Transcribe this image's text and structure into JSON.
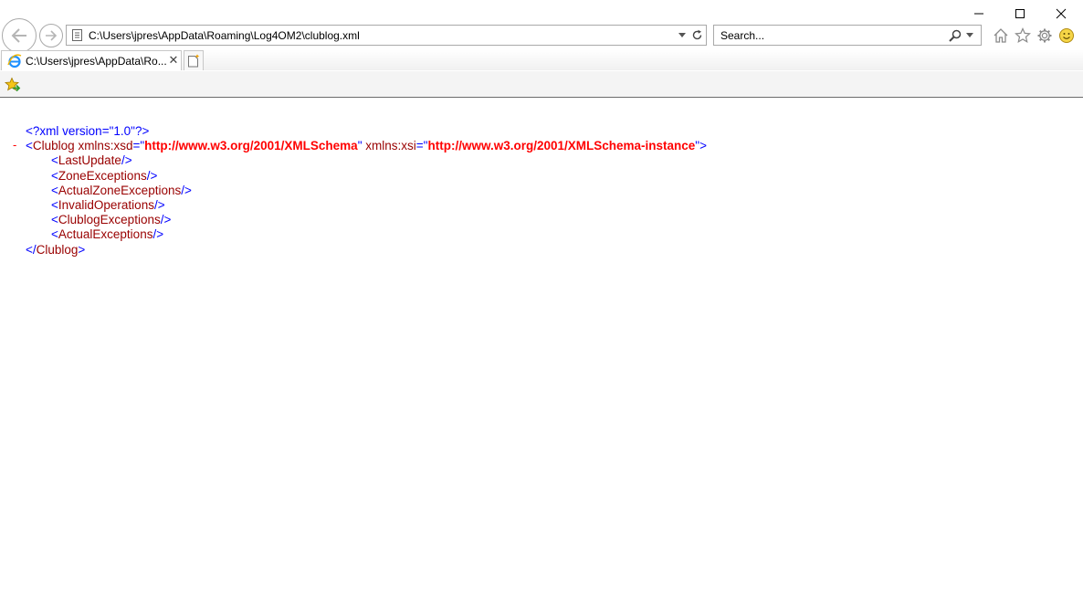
{
  "browser": {
    "address": "C:\\Users\\jpres\\AppData\\Roaming\\Log4OM2\\clublog.xml",
    "search_placeholder": "Search...",
    "tab_title": "C:\\Users\\jpres\\AppData\\Ro...",
    "tab_close": "✕",
    "icons": [
      "back-arrow-icon",
      "forward-arrow-icon",
      "page-icon",
      "dropdown-arrow-icon",
      "refresh-icon",
      "search-icon",
      "home-icon",
      "star-icon",
      "gear-icon",
      "smiley-icon",
      "ie-logo-icon",
      "new-tab-icon",
      "add-favorite-icon",
      "minimize-icon",
      "maximize-icon",
      "close-icon"
    ]
  },
  "xml": {
    "collapse_symbol": "-",
    "pi": {
      "open": "<?",
      "name": "xml",
      "attr": "version",
      "eq_quote": "=\"",
      "value": "1.0",
      "close": "\"?>"
    },
    "root": {
      "lt": "<",
      "name": "Clublog",
      "attr1": "xmlns:xsd",
      "eq_open": "=\"",
      "value1": "http://www.w3.org/2001/XMLSchema",
      "close_quote": "\"",
      "attr2": "xmlns:xsi",
      "value2": "http://www.w3.org/2001/XMLSchema-instance",
      "end": "\">",
      "close_lt": "</",
      "gt": ">"
    },
    "children": [
      {
        "lt": "<",
        "name": "LastUpdate",
        "end": "/>"
      },
      {
        "lt": "<",
        "name": "ZoneExceptions",
        "end": "/>"
      },
      {
        "lt": "<",
        "name": "ActualZoneExceptions",
        "end": "/>"
      },
      {
        "lt": "<",
        "name": "InvalidOperations",
        "end": "/>"
      },
      {
        "lt": "<",
        "name": "ClublogExceptions",
        "end": "/>"
      },
      {
        "lt": "<",
        "name": "ActualExceptions",
        "end": "/>"
      }
    ]
  }
}
